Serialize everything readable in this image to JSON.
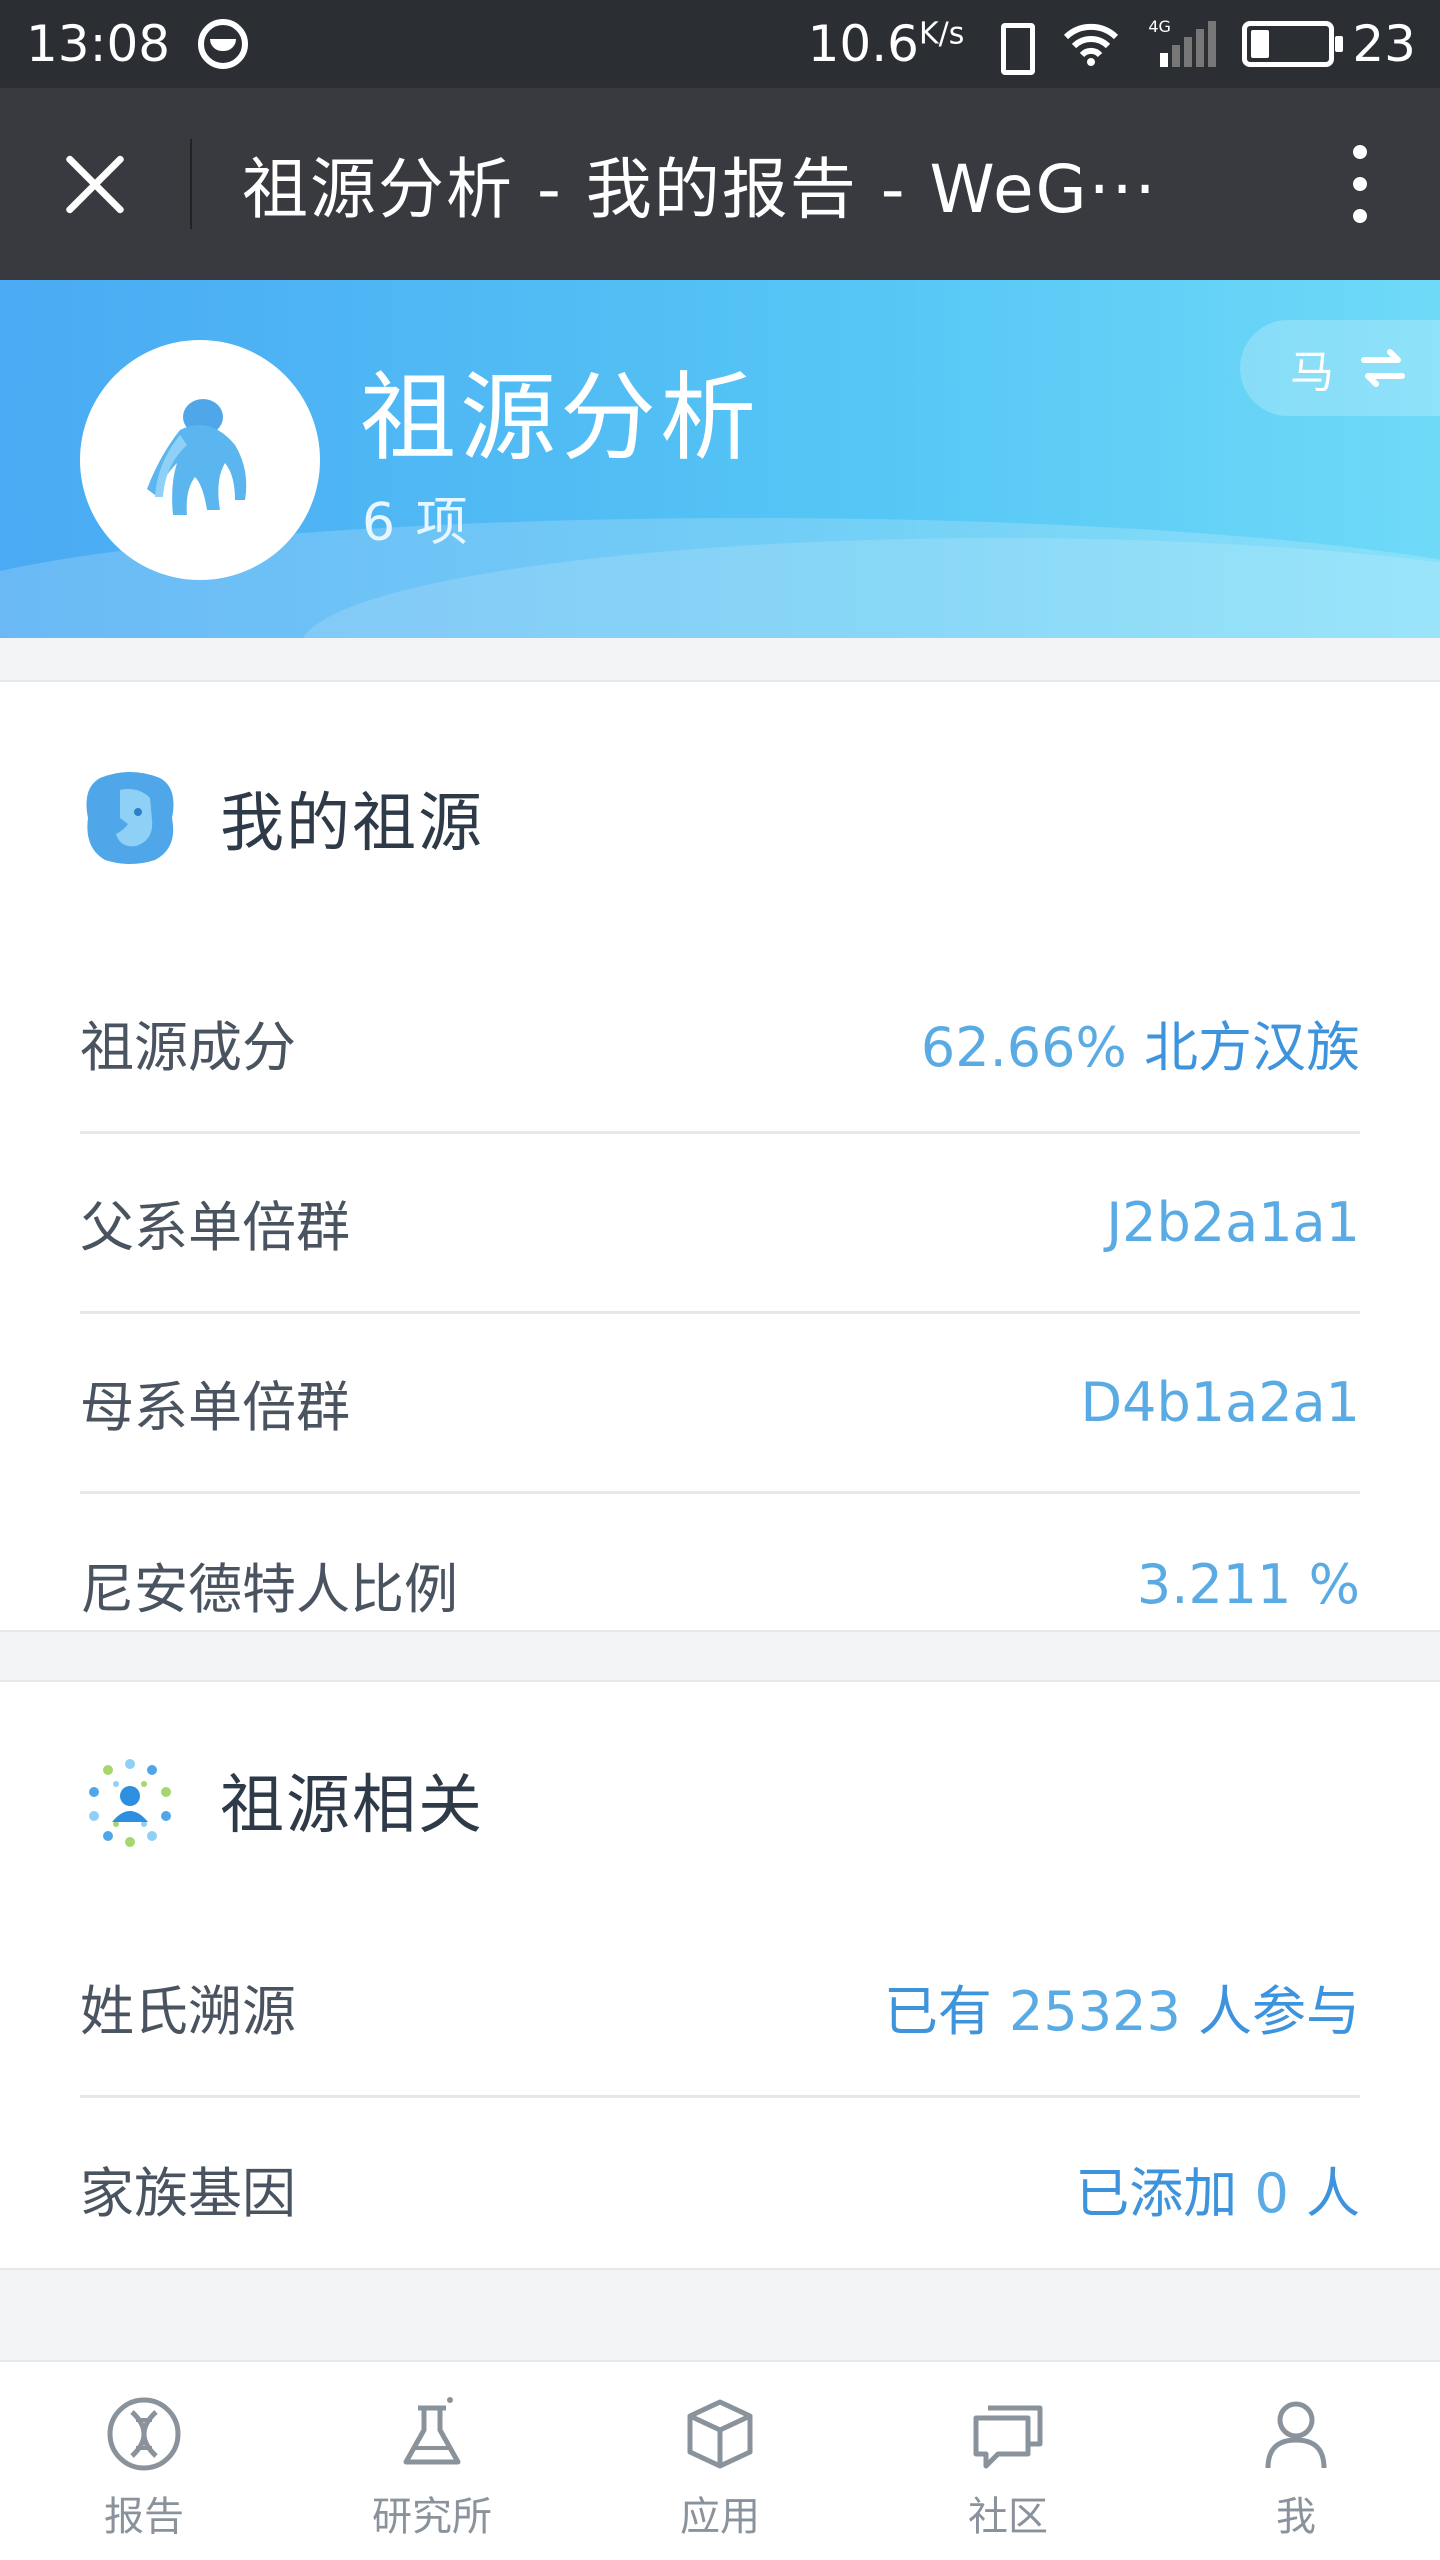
{
  "status_bar": {
    "time": "13:08",
    "network_speed": "10.6",
    "network_speed_unit": "K/s",
    "network_type": "4G",
    "battery_level": "23"
  },
  "title_bar": {
    "title": "祖源分析 - 我的报告 - WeG···"
  },
  "hero": {
    "title": "祖源分析",
    "count": "6 项",
    "switch_label": "马"
  },
  "my_ancestry": {
    "title": "我的祖源",
    "rows": [
      {
        "label": "祖源成分",
        "value_prefix": "62.66%",
        "value_strong": " 北方汉族"
      },
      {
        "label": "父系单倍群",
        "value": "J2b2a1a1"
      },
      {
        "label": "母系单倍群",
        "value": "D4b1a2a1"
      },
      {
        "label": "尼安德特人比例",
        "value": "3.211 %"
      }
    ]
  },
  "related": {
    "title": "祖源相关",
    "rows": [
      {
        "label": "姓氏溯源",
        "value_a": "已有 ",
        "value_num": "25323",
        "value_b": " 人参与"
      },
      {
        "label": "家族基因",
        "value_a": "已添加 ",
        "value_num": "0",
        "value_b": " 人"
      }
    ]
  },
  "tab_bar": {
    "tabs": [
      {
        "label": "报告",
        "icon": "dna-icon"
      },
      {
        "label": "研究所",
        "icon": "flask-icon"
      },
      {
        "label": "应用",
        "icon": "cube-icon"
      },
      {
        "label": "社区",
        "icon": "chat-icon"
      },
      {
        "label": "我",
        "icon": "person-icon"
      }
    ]
  },
  "colors": {
    "accent": "#5aabe4",
    "header_dark": "#393a3f",
    "hero_start": "#4aaaf3",
    "hero_end": "#6fdaf8"
  }
}
